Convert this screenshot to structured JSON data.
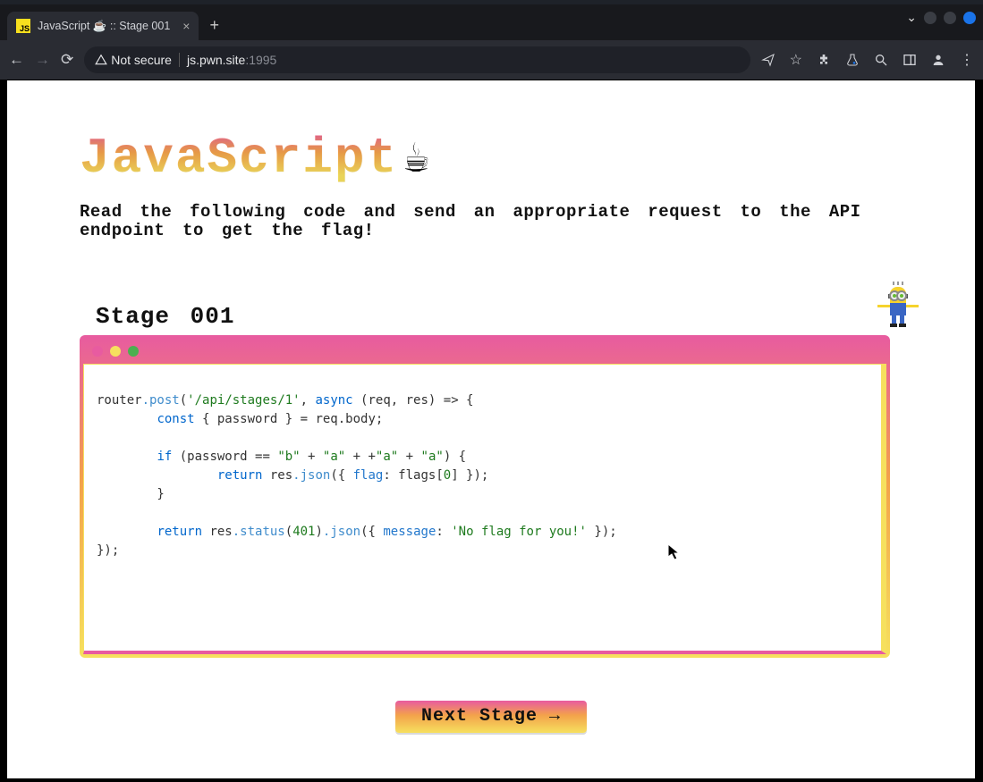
{
  "browser": {
    "tab": {
      "title": "JavaScript ☕ :: Stage 001",
      "favicon_text": "JS"
    },
    "security_label": "Not secure",
    "url_host": "js.pwn.site",
    "url_port": ":1995"
  },
  "page": {
    "title_text": "JavaScript",
    "cup_emoji": "☕",
    "instructions": "Read the following code and send an appropriate request to the API endpoint to get the flag!",
    "stage_label": "Stage 001",
    "next_button": "Next Stage →"
  },
  "code": {
    "l1_a": "router",
    "l1_post": ".post",
    "l1_b": "(",
    "l1_str": "'/api/stages/1'",
    "l1_c": ", ",
    "l1_async": "async",
    "l1_d": " (req, res) => {",
    "l2_a": "        ",
    "l2_const": "const",
    "l2_b": " { password } = req.body;",
    "l3": "",
    "l4_a": "        ",
    "l4_if": "if",
    "l4_b": " (password == ",
    "l4_s1": "\"b\"",
    "l4_p1": " + ",
    "l4_s2": "\"a\"",
    "l4_p2": " + +",
    "l4_s3": "\"a\"",
    "l4_p3": " + ",
    "l4_s4": "\"a\"",
    "l4_c": ") {",
    "l5_a": "                ",
    "l5_ret": "return",
    "l5_b": " res",
    "l5_json": ".json",
    "l5_c": "({ ",
    "l5_flag": "flag",
    "l5_d": ": flags[",
    "l5_zero": "0",
    "l5_e": "] });",
    "l6": "        }",
    "l7": "",
    "l8_a": "        ",
    "l8_ret": "return",
    "l8_b": " res",
    "l8_status": ".status",
    "l8_c": "(",
    "l8_401": "401",
    "l8_d": ")",
    "l8_json": ".json",
    "l8_e": "({ ",
    "l8_msg": "message",
    "l8_f": ": ",
    "l8_str": "'No flag for you!'",
    "l8_g": " });",
    "l9": "});"
  }
}
